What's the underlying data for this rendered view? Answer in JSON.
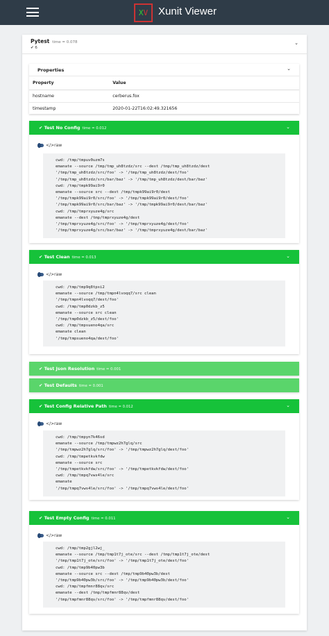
{
  "app": {
    "title": "Xunit Viewer",
    "logo_x": "X",
    "logo_v": "V"
  },
  "suite": {
    "name": "Pytest",
    "time": "time = 0.078",
    "count": "✔ 6"
  },
  "properties": {
    "title": "Properties",
    "columns": [
      "Property",
      "Value"
    ],
    "rows": [
      {
        "property": "hostname",
        "value": "cerberus.fox"
      },
      {
        "property": "timestamp",
        "value": "2020-01-22T16:02:49.321656"
      }
    ]
  },
  "raw_label": "</>raw",
  "tests": [
    {
      "name": "Test No Config",
      "time": "time = 0.012",
      "code": "cwd: /tmp/tmpuv0uzm7s\nemanate --source /tmp/tmp_uh8tzdz/src --dest /tmp/tmp_uh8tzdz/dest\n'/tmp/tmp_uh8tzdz/src/foo' -> '/tmp/tmp_uh8tzdz/dest/foo'\n'/tmp/tmp_uh8tzdz/src/bar/baz' -> '/tmp/tmp_uh8tzdz/dest/bar/baz'\ncwd: /tmp/tmpk99ai9r0\nemanate --source src --dest /tmp/tmpk99ai9r0/dest\n'/tmp/tmpk99ai9r0/src/foo' -> '/tmp/tmpk99ai9r0/dest/foo'\n'/tmp/tmpk99ai9r0/src/bar/baz' -> '/tmp/tmpk99ai9r0/dest/bar/baz'\ncwd: /tmp/tmprxyuze4g/src\nemanate --dest /tmp/tmprxyuze4g/dest\n'/tmp/tmprxyuze4g/src/foo' -> '/tmp/tmprxyuze4g/dest/foo'\n'/tmp/tmprxyuze4g/src/bar/baz' -> '/tmp/tmprxyuze4g/dest/bar/baz'"
    },
    {
      "name": "Test Clean",
      "time": "time = 0.013",
      "code": "cwd: /tmp/tmp9q8tpxi2\nemanate --source /tmp/tmpn4lvoqq7/src clean\n'/tmp/tmpn4lvoqq7/dest/foo'\ncwd: /tmp/tmp0dzkb_z5\nemanate --source src clean\n'/tmp/tmp0dzkb_z5/dest/foo'\ncwd: /tmp/tmpsueno4qa/src\nemanate clean\n'/tmp/tmpsueno4qa/dest/foo'"
    },
    {
      "name": "Test Json Resolution",
      "time": "time = 0.001"
    },
    {
      "name": "Test Defaults",
      "time": "time = 0.001"
    },
    {
      "name": "Test Config Relative Path",
      "time": "time = 0.012",
      "code": "cwd: /tmp/tmpyn7k46sd\nemanate --source /tmp/tmpwz2h7glq/src\n'/tmp/tmpwz2h7glq/src/foo' -> '/tmp/tmpwz2h7glq/dest/foo'\ncwd: /tmp/tmpetkvkfdw\nemanate --source src\n'/tmp/tmpetkvkfdw/src/foo' -> '/tmp/tmpetkvkfdw/dest/foo'\ncwd: /tmp/tmpq7vws4le/src\nemanate\n'/tmp/tmpq7vws4le/src/foo' -> '/tmp/tmpq7vws4le/dest/foo'"
    },
    {
      "name": "Test Empty Config",
      "time": "time = 0.011",
      "code": "cwd: /tmp/tmp2gjl2wj_\nemanate --source /tmp/tmp1t7j_ote/src --dest /tmp/tmp1t7j_ote/dest\n'/tmp/tmp1t7j_ote/src/foo' -> '/tmp/tmp1t7j_ote/dest/foo'\ncwd: /tmp/tmp9b40pw3b\nemanate --source src --dest /tmp/tmp9b40pw3b/dest\n'/tmp/tmp9b40pw3b/src/foo' -> '/tmp/tmp9b40pw3b/dest/foo'\ncwd: /tmp/tmpfmnr88qv/src\nemanate --dest /tmp/tmpfmnr88qv/dest\n'/tmp/tmpfmnr88qv/src/foo' -> '/tmp/tmpfmnr88qv/dest/foo'"
    }
  ],
  "colors": {
    "navbar": "#2f3c48",
    "pass": "#16c23a",
    "pass_collapsed": "#5ad56b"
  }
}
